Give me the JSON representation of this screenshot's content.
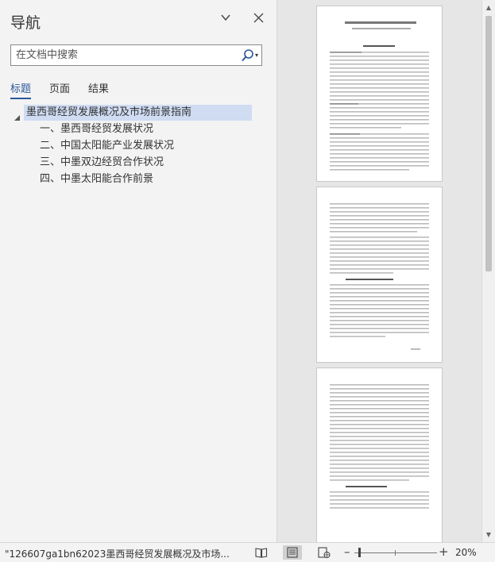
{
  "nav": {
    "title": "导航",
    "search_placeholder": "在文档中搜索",
    "tabs": [
      {
        "label": "标题",
        "active": true
      },
      {
        "label": "页面",
        "active": false
      },
      {
        "label": "结果",
        "active": false
      }
    ],
    "headings": [
      {
        "label": "墨西哥经贸发展概况及市场前景指南",
        "level": 1,
        "selected": true
      },
      {
        "label": "一、墨西哥经贸发展状况",
        "level": 2,
        "selected": false
      },
      {
        "label": "二、中国太阳能产业发展状况",
        "level": 2,
        "selected": false
      },
      {
        "label": "三、中墨双边经贸合作状况",
        "level": 2,
        "selected": false
      },
      {
        "label": "四、中墨太阳能合作前景",
        "level": 2,
        "selected": false
      }
    ]
  },
  "status": {
    "filename": "\"126607ga1bn62023墨西哥经贸发展概况及市场...",
    "zoom": "20%",
    "zoom_fraction": 0.06
  },
  "colors": {
    "accent": "#2b579a",
    "selection": "#cfdcf2"
  }
}
